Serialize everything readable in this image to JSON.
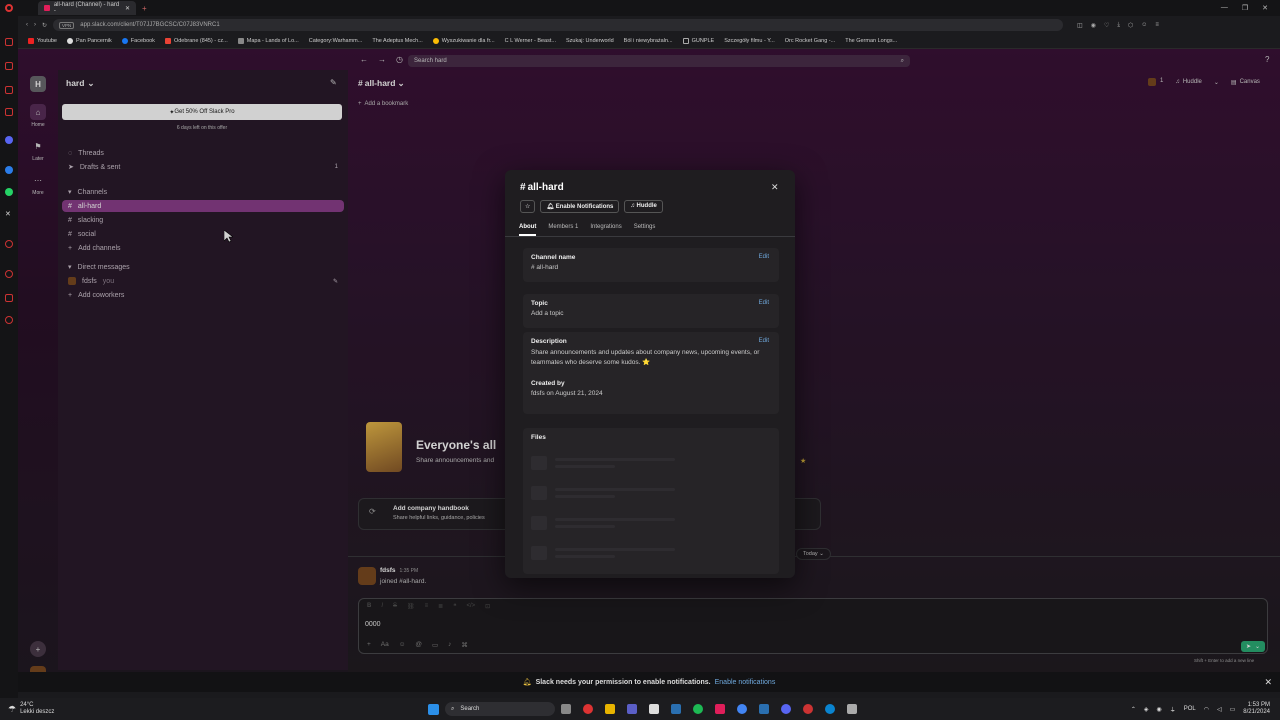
{
  "browser": {
    "tab_title": "all-hard (Channel) - hard -",
    "url": "app.slack.com/client/T07JJ7BGCSC/C07J83VNRC1",
    "bookmarks": [
      "Youtube",
      "Pan Pancernik",
      "Facebook",
      "Odebrane (845) - cz...",
      "Mapa - Lands of Lo...",
      "Category:Warhamm...",
      "The Adeptus Mech...",
      "Wyszukiwanie dla fr...",
      "C L Werner - Beast...",
      "Szukaj: Underworld",
      "Ból i niewybrażaln...",
      "GUNPLE",
      "Szczegóły filmu - Y...",
      "Orc Rocket Gang -...",
      "The German Longs..."
    ]
  },
  "slack": {
    "search_placeholder": "Search hard",
    "workspace_initial": "H",
    "workspace_name": "hard",
    "rail": {
      "home": "Home",
      "later": "Later",
      "more": "More"
    },
    "promo": {
      "button": "Get 50% Off Slack Pro",
      "note": "6 days left on this offer"
    },
    "sidebar": {
      "threads": "Threads",
      "drafts": "Drafts & sent",
      "drafts_count": "1",
      "channels_header": "Channels",
      "channels": [
        "all-hard",
        "slacking",
        "social"
      ],
      "add_channels": "Add channels",
      "dm_header": "Direct messages",
      "dm_user": "fdsfs",
      "dm_you": "you",
      "add_coworkers": "Add coworkers"
    },
    "header": {
      "channel": "all-hard",
      "add_bookmark": "Add a bookmark",
      "member_count": "1",
      "huddle": "Huddle",
      "canvas": "Canvas"
    },
    "welcome": {
      "title": "Everyone's all",
      "subtitle": "Share announcements and",
      "handbook_title": "Add company handbook",
      "handbook_sub": "Share helpful links, guidance, policies"
    },
    "message": {
      "today": "Today",
      "user": "fdsfs",
      "time": "1:35 PM",
      "text": "joined #all-hard."
    },
    "composer": {
      "text": "0000",
      "hint": "Shift + Enter to add a new line"
    },
    "modal": {
      "title": "all-hard",
      "enable_notifications": "Enable Notifications",
      "huddle": "Huddle",
      "tabs": [
        "About",
        "Members 1",
        "Integrations",
        "Settings"
      ],
      "channel_name_label": "Channel name",
      "channel_name": "# all-hard",
      "edit": "Edit",
      "topic_label": "Topic",
      "topic": "Add a topic",
      "description_label": "Description",
      "description": "Share announcements and updates about company news, upcoming events, or teammates who deserve some kudos. ⭐",
      "created_label": "Created by",
      "created": "fdsfs on August 21, 2024",
      "files_label": "Files"
    },
    "notification_bar": {
      "text": "Slack needs your permission to enable notifications.",
      "link": "Enable notifications"
    }
  },
  "taskbar": {
    "weather_temp": "24°C",
    "weather_text": "Lekki deszcz",
    "search": "Search",
    "lang": "POL",
    "time": "1:53 PM",
    "date": "8/21/2024"
  },
  "colors": {
    "accent": "#8b3f8b",
    "link": "#6fa8dc",
    "green": "#2bac76"
  }
}
